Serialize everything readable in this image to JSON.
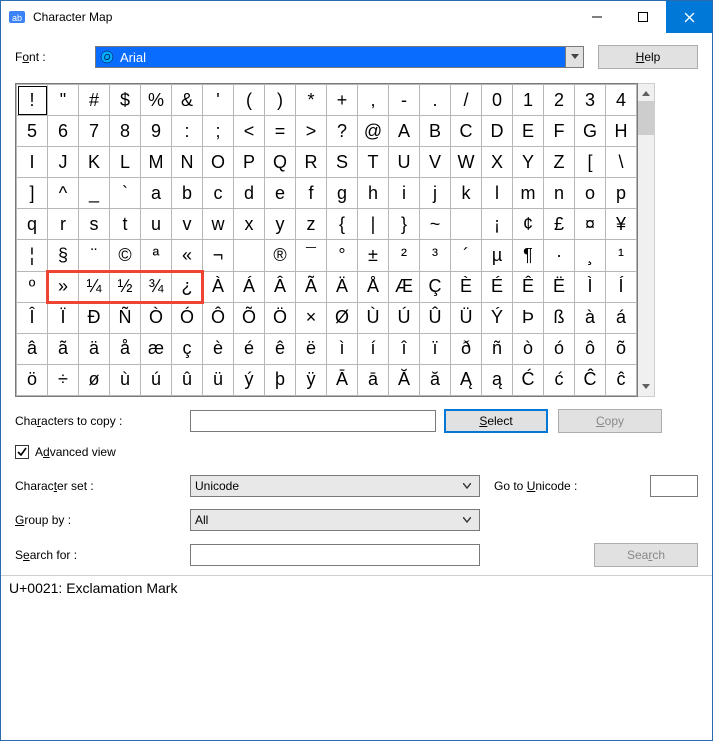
{
  "window": {
    "title": "Character Map"
  },
  "labels": {
    "font_pre": "F",
    "font_u": "o",
    "font_post": "nt :",
    "help_u": "H",
    "help_post": "elp",
    "copychars_prefix": "Cha",
    "copychars_u": "r",
    "copychars_suffix": "acters to copy :",
    "select_u": "S",
    "select_post": "elect",
    "copy_u": "C",
    "copy_post": "opy",
    "adv_prefix": "A",
    "adv_u": "d",
    "adv_suffix": "vanced view",
    "charset_prefix": "Charac",
    "charset_u": "t",
    "charset_suffix": "er set :",
    "goto_prefix": "Go to ",
    "goto_u": "U",
    "goto_suffix": "nicode :",
    "group_u": "G",
    "group_post": "roup by :",
    "search_prefix": "S",
    "search_u": "e",
    "search_suffix": "arch for :",
    "searchbtn_prefix": "Sea",
    "searchbtn_u": "r",
    "searchbtn_suffix": "ch"
  },
  "font": {
    "selected": "Arial"
  },
  "charset": {
    "selected": "Unicode"
  },
  "groupby": {
    "selected": "All"
  },
  "copy_field": "",
  "goto_field": "",
  "search_field": "",
  "advanced_checked": true,
  "status": "U+0021: Exclamation Mark",
  "highlight": {
    "row": 7,
    "col_start": 1,
    "col_end": 5
  },
  "grid": [
    [
      "!",
      "\"",
      "#",
      "$",
      "%",
      "&",
      "'",
      "(",
      ")",
      "*",
      "+",
      ",",
      "-",
      ".",
      "/",
      "0",
      "1",
      "2",
      "3",
      "4"
    ],
    [
      "5",
      "6",
      "7",
      "8",
      "9",
      ":",
      ";",
      "<",
      "=",
      ">",
      "?",
      "@",
      "A",
      "B",
      "C",
      "D",
      "E",
      "F",
      "G",
      "H"
    ],
    [
      "I",
      "J",
      "K",
      "L",
      "M",
      "N",
      "O",
      "P",
      "Q",
      "R",
      "S",
      "T",
      "U",
      "V",
      "W",
      "X",
      "Y",
      "Z",
      "[",
      "\\"
    ],
    [
      "]",
      "^",
      "_",
      "`",
      "a",
      "b",
      "c",
      "d",
      "e",
      "f",
      "g",
      "h",
      "i",
      "j",
      "k",
      "l",
      "m",
      "n",
      "o",
      "p"
    ],
    [
      "q",
      "r",
      "s",
      "t",
      "u",
      "v",
      "w",
      "x",
      "y",
      "z",
      "{",
      "|",
      "}",
      "~",
      " ",
      "¡",
      "¢",
      "£",
      "¤",
      "¥"
    ],
    [
      "¦",
      "§",
      "¨",
      "©",
      "ª",
      "«",
      "¬",
      "­",
      "®",
      "¯",
      "°",
      "±",
      "²",
      "³",
      "´",
      "µ",
      "¶",
      "·",
      "¸",
      "¹"
    ],
    [
      "º",
      "»",
      "¼",
      "½",
      "¾",
      "¿",
      "À",
      "Á",
      "Â",
      "Ã",
      "Ä",
      "Å",
      "Æ",
      "Ç",
      "È",
      "É",
      "Ê",
      "Ë",
      "Ì",
      "Í"
    ],
    [
      "Î",
      "Ï",
      "Ð",
      "Ñ",
      "Ò",
      "Ó",
      "Ô",
      "Õ",
      "Ö",
      "×",
      "Ø",
      "Ù",
      "Ú",
      "Û",
      "Ü",
      "Ý",
      "Þ",
      "ß",
      "à",
      "á"
    ],
    [
      "â",
      "ã",
      "ä",
      "å",
      "æ",
      "ç",
      "è",
      "é",
      "ê",
      "ë",
      "ì",
      "í",
      "î",
      "ï",
      "ð",
      "ñ",
      "ò",
      "ó",
      "ô",
      "õ"
    ],
    [
      "ö",
      "÷",
      "ø",
      "ù",
      "ú",
      "û",
      "ü",
      "ý",
      "þ",
      "ÿ",
      "Ā",
      "ā",
      "Ă",
      "ă",
      "Ą",
      "ą",
      "Ć",
      "ć",
      "Ĉ",
      "ĉ"
    ]
  ]
}
